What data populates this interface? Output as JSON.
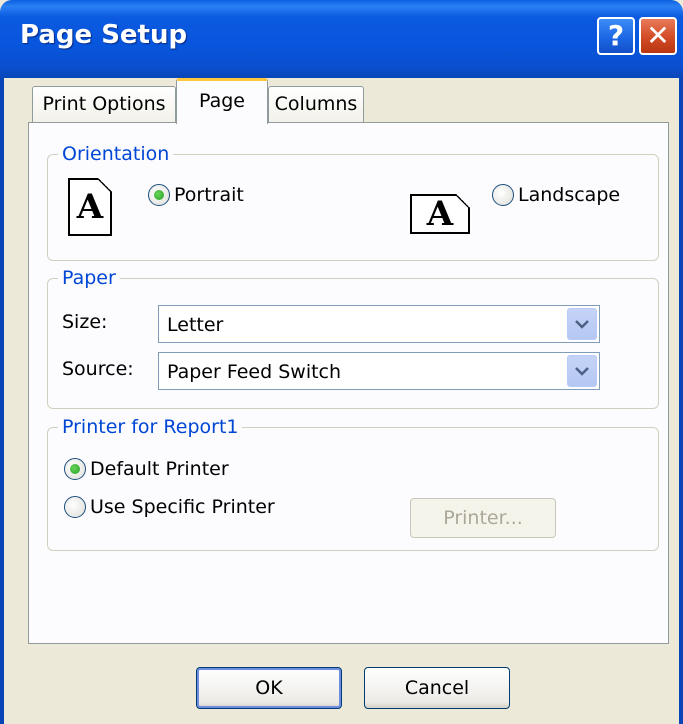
{
  "window": {
    "title": "Page Setup"
  },
  "titlebar": {
    "help_icon": "?",
    "close_icon": "✕"
  },
  "tabs": [
    {
      "label": "Print Options",
      "selected": false
    },
    {
      "label": "Page",
      "selected": true
    },
    {
      "label": "Columns",
      "selected": false
    }
  ],
  "orientation": {
    "title": "Orientation",
    "portrait": {
      "label": "Portrait",
      "checked": true,
      "icon_glyph": "A"
    },
    "landscape": {
      "label": "Landscape",
      "checked": false,
      "icon_glyph": "A"
    }
  },
  "paper": {
    "title": "Paper",
    "size_label": "Size:",
    "size_value": "Letter",
    "source_label": "Source:",
    "source_value": "Paper Feed Switch"
  },
  "printer": {
    "title": "Printer for Report1",
    "default_label": "Default Printer",
    "default_checked": true,
    "specific_label": "Use Specific Printer",
    "specific_checked": false,
    "printer_button": "Printer..."
  },
  "buttons": {
    "ok": "OK",
    "cancel": "Cancel"
  },
  "colors": {
    "titlebar": "#0755DC",
    "group_title": "#0046D5",
    "dialog_bg": "#ECE9D8"
  }
}
